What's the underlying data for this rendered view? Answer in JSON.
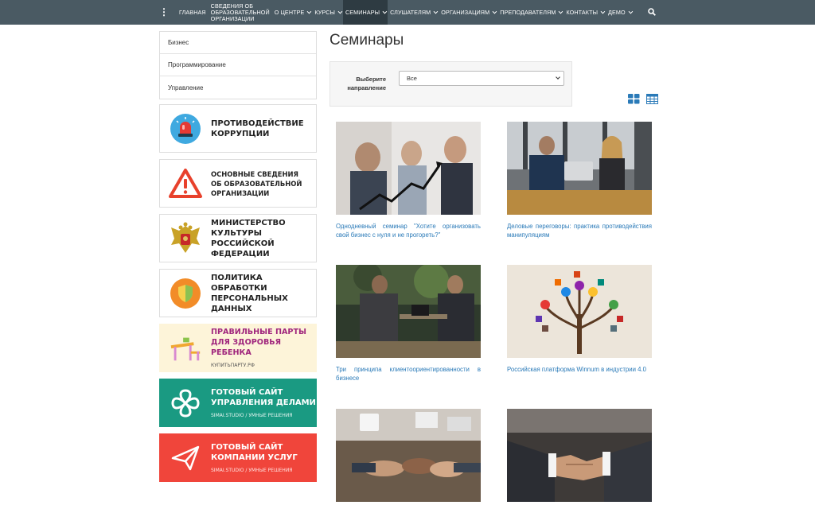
{
  "nav": {
    "items": [
      {
        "label": "ГЛАВНАЯ",
        "has_caret": false
      },
      {
        "label": "СВЕДЕНИЯ ОБ ОБРАЗОВАТЕЛЬНОЙ ОРГАНИЗАЦИИ",
        "lines": [
          "СВЕДЕНИЯ ОБ",
          "ОБРАЗОВАТЕЛЬНОЙ",
          "ОРГАНИЗАЦИИ"
        ],
        "has_caret": false
      },
      {
        "label": "О ЦЕНТРЕ",
        "has_caret": true
      },
      {
        "label": "КУРСЫ",
        "has_caret": true
      },
      {
        "label": "СЕМИНАРЫ",
        "has_caret": true,
        "active": true
      },
      {
        "label": "СЛУШАТЕЛЯМ",
        "has_caret": true
      },
      {
        "label": "ОРГАНИЗАЦИЯМ",
        "has_caret": true
      },
      {
        "label": "ПРЕПОДАВАТЕЛЯМ",
        "has_caret": true
      },
      {
        "label": "КОНТАКТЫ",
        "has_caret": true
      },
      {
        "label": "ДЕМО",
        "has_caret": true
      }
    ],
    "bg_color": "#4a5a63",
    "active_color": "#2e3b42"
  },
  "sidebar": {
    "menu": [
      "Бизнес",
      "Программирование",
      "Управление"
    ],
    "banners": [
      {
        "icon": "siren-icon",
        "lines": [
          "ПРОТИВОДЕЙСТВИЕ",
          "КОРРУПЦИИ"
        ]
      },
      {
        "icon": "warning-icon",
        "lines": [
          "ОСНОВНЫЕ СВЕДЕНИЯ",
          "ОБ ОБРАЗОВАТЕЛЬНОЙ",
          "ОРГАНИЗАЦИИ"
        ]
      },
      {
        "icon": "coat-of-arms-icon",
        "lines": [
          "МИНИСТЕРСТВО КУЛЬТУРЫ",
          "РОССИЙСКОЙ ФЕДЕРАЦИИ"
        ]
      },
      {
        "icon": "shield-icon",
        "lines": [
          "ПОЛИТИКА ОБРАБОТКИ",
          "ПЕРСОНАЛЬНЫХ ДАННЫХ"
        ]
      },
      {
        "icon": "school-desk-icon",
        "lines": [
          "ПРАВИЛЬНЫЕ ПАРТЫ",
          "ДЛЯ ЗДОРОВЬЯ РЕБЕНКА"
        ],
        "sub": "КУПИТЬПАРТУ.РФ"
      },
      {
        "icon": "flower-logo-icon",
        "lines": [
          "ГОТОВЫЙ САЙТ",
          "УПРАВЛЕНИЯ ДЕЛАМИ"
        ],
        "sub": "SIMAI.STUDIO / УМНЫЕ РЕШЕНИЯ"
      },
      {
        "icon": "paper-plane-icon",
        "lines": [
          "ГОТОВЫЙ САЙТ",
          "КОМПАНИИ УСЛУГ"
        ],
        "sub": "SIMAI.STUDIO / УМНЫЕ РЕШЕНИЯ"
      }
    ]
  },
  "main": {
    "title": "Семинары",
    "filter": {
      "label": "Выберите направление",
      "value": "Все"
    },
    "cards": [
      {
        "caption": "Однодневный семинар \"Хотите организовать свой бизнес с нуля и не прогореть?\""
      },
      {
        "caption": "Деловые переговоры: практика противодействия манипуляциям"
      },
      {
        "caption": "Три принципа клиентоориентированности в бизнесе"
      },
      {
        "caption": "Российская платформа Winnum в индустрии 4.0"
      },
      {
        "caption": ""
      },
      {
        "caption": ""
      }
    ],
    "link_color": "#2a7ab8",
    "view_icon_color": "#2a7ab8"
  }
}
